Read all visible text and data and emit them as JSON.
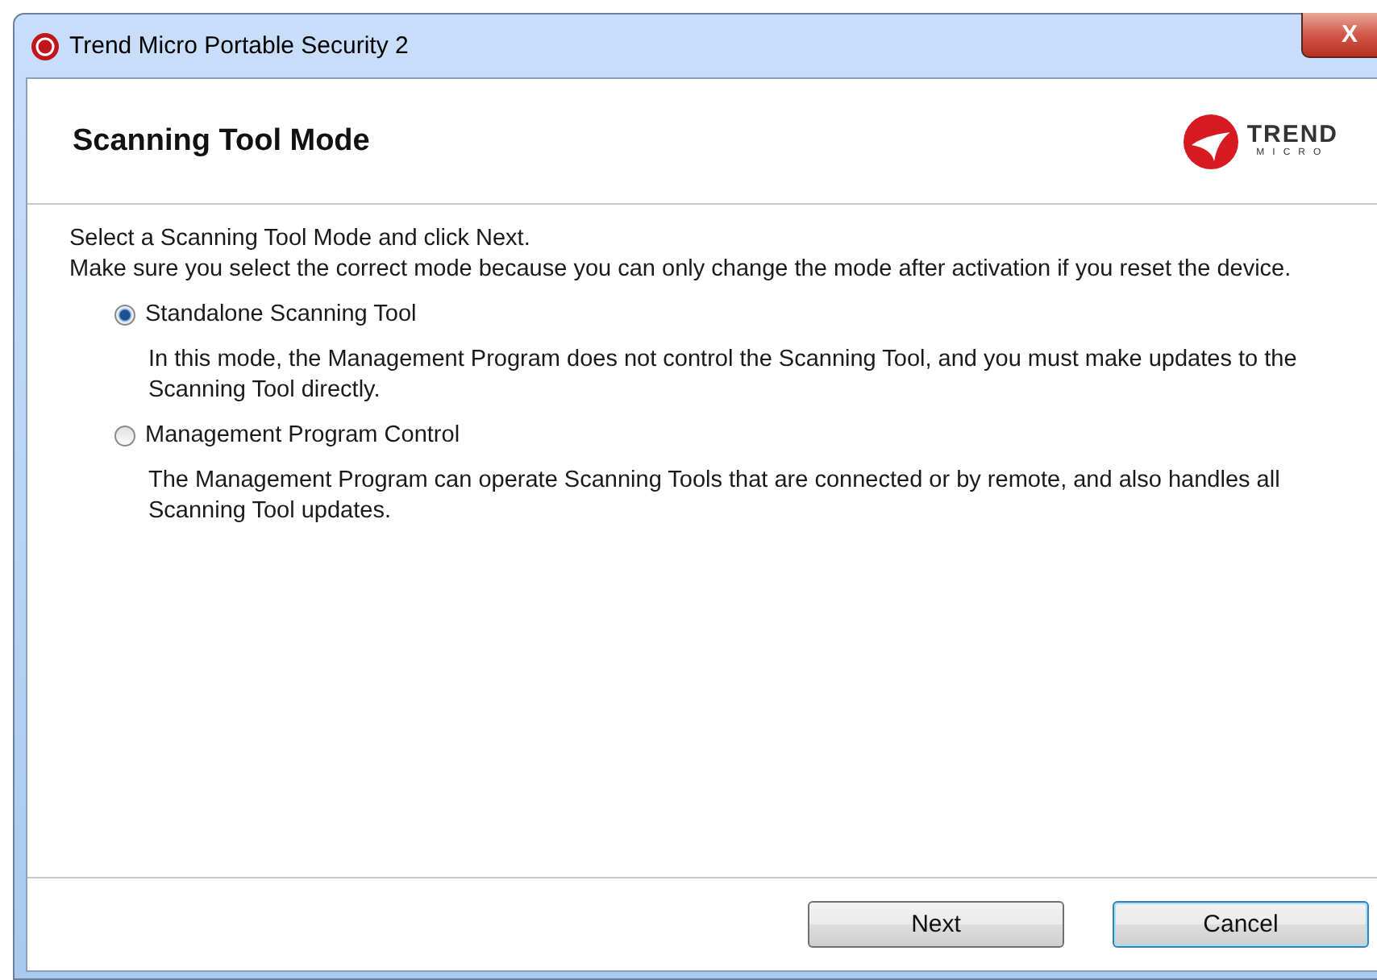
{
  "window": {
    "title": "Trend Micro Portable Security 2",
    "close": "X"
  },
  "header": {
    "title": "Scanning Tool Mode",
    "logo": {
      "line_1": "TREND",
      "line_2": "MICRO"
    }
  },
  "intro": [
    "Select a Scanning Tool Mode and click Next.",
    "Make sure you select the correct mode because you can only change the mode after activation if you reset the device."
  ],
  "options": [
    {
      "label": "Standalone Scanning Tool",
      "selected": true,
      "description": "In this mode, the Management Program does not control the Scanning Tool, and you must make updates to the Scanning Tool directly."
    },
    {
      "label": "Management Program Control",
      "selected": false,
      "description": "The Management Program can operate Scanning Tools that are connected or by remote, and also handles all Scanning Tool updates."
    }
  ],
  "buttons": [
    {
      "label": "Next",
      "focused": false
    },
    {
      "label": "Cancel",
      "focused": true
    }
  ]
}
